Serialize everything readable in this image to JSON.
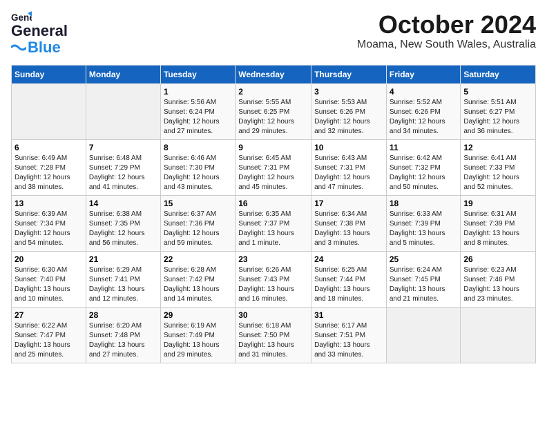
{
  "logo": {
    "general": "General",
    "blue": "Blue"
  },
  "header": {
    "month": "October 2024",
    "location": "Moama, New South Wales, Australia"
  },
  "weekdays": [
    "Sunday",
    "Monday",
    "Tuesday",
    "Wednesday",
    "Thursday",
    "Friday",
    "Saturday"
  ],
  "weeks": [
    [
      {
        "day": "",
        "info": ""
      },
      {
        "day": "",
        "info": ""
      },
      {
        "day": "1",
        "info": "Sunrise: 5:56 AM\nSunset: 6:24 PM\nDaylight: 12 hours\nand 27 minutes."
      },
      {
        "day": "2",
        "info": "Sunrise: 5:55 AM\nSunset: 6:25 PM\nDaylight: 12 hours\nand 29 minutes."
      },
      {
        "day": "3",
        "info": "Sunrise: 5:53 AM\nSunset: 6:26 PM\nDaylight: 12 hours\nand 32 minutes."
      },
      {
        "day": "4",
        "info": "Sunrise: 5:52 AM\nSunset: 6:26 PM\nDaylight: 12 hours\nand 34 minutes."
      },
      {
        "day": "5",
        "info": "Sunrise: 5:51 AM\nSunset: 6:27 PM\nDaylight: 12 hours\nand 36 minutes."
      }
    ],
    [
      {
        "day": "6",
        "info": "Sunrise: 6:49 AM\nSunset: 7:28 PM\nDaylight: 12 hours\nand 38 minutes."
      },
      {
        "day": "7",
        "info": "Sunrise: 6:48 AM\nSunset: 7:29 PM\nDaylight: 12 hours\nand 41 minutes."
      },
      {
        "day": "8",
        "info": "Sunrise: 6:46 AM\nSunset: 7:30 PM\nDaylight: 12 hours\nand 43 minutes."
      },
      {
        "day": "9",
        "info": "Sunrise: 6:45 AM\nSunset: 7:31 PM\nDaylight: 12 hours\nand 45 minutes."
      },
      {
        "day": "10",
        "info": "Sunrise: 6:43 AM\nSunset: 7:31 PM\nDaylight: 12 hours\nand 47 minutes."
      },
      {
        "day": "11",
        "info": "Sunrise: 6:42 AM\nSunset: 7:32 PM\nDaylight: 12 hours\nand 50 minutes."
      },
      {
        "day": "12",
        "info": "Sunrise: 6:41 AM\nSunset: 7:33 PM\nDaylight: 12 hours\nand 52 minutes."
      }
    ],
    [
      {
        "day": "13",
        "info": "Sunrise: 6:39 AM\nSunset: 7:34 PM\nDaylight: 12 hours\nand 54 minutes."
      },
      {
        "day": "14",
        "info": "Sunrise: 6:38 AM\nSunset: 7:35 PM\nDaylight: 12 hours\nand 56 minutes."
      },
      {
        "day": "15",
        "info": "Sunrise: 6:37 AM\nSunset: 7:36 PM\nDaylight: 12 hours\nand 59 minutes."
      },
      {
        "day": "16",
        "info": "Sunrise: 6:35 AM\nSunset: 7:37 PM\nDaylight: 13 hours\nand 1 minute."
      },
      {
        "day": "17",
        "info": "Sunrise: 6:34 AM\nSunset: 7:38 PM\nDaylight: 13 hours\nand 3 minutes."
      },
      {
        "day": "18",
        "info": "Sunrise: 6:33 AM\nSunset: 7:39 PM\nDaylight: 13 hours\nand 5 minutes."
      },
      {
        "day": "19",
        "info": "Sunrise: 6:31 AM\nSunset: 7:39 PM\nDaylight: 13 hours\nand 8 minutes."
      }
    ],
    [
      {
        "day": "20",
        "info": "Sunrise: 6:30 AM\nSunset: 7:40 PM\nDaylight: 13 hours\nand 10 minutes."
      },
      {
        "day": "21",
        "info": "Sunrise: 6:29 AM\nSunset: 7:41 PM\nDaylight: 13 hours\nand 12 minutes."
      },
      {
        "day": "22",
        "info": "Sunrise: 6:28 AM\nSunset: 7:42 PM\nDaylight: 13 hours\nand 14 minutes."
      },
      {
        "day": "23",
        "info": "Sunrise: 6:26 AM\nSunset: 7:43 PM\nDaylight: 13 hours\nand 16 minutes."
      },
      {
        "day": "24",
        "info": "Sunrise: 6:25 AM\nSunset: 7:44 PM\nDaylight: 13 hours\nand 18 minutes."
      },
      {
        "day": "25",
        "info": "Sunrise: 6:24 AM\nSunset: 7:45 PM\nDaylight: 13 hours\nand 21 minutes."
      },
      {
        "day": "26",
        "info": "Sunrise: 6:23 AM\nSunset: 7:46 PM\nDaylight: 13 hours\nand 23 minutes."
      }
    ],
    [
      {
        "day": "27",
        "info": "Sunrise: 6:22 AM\nSunset: 7:47 PM\nDaylight: 13 hours\nand 25 minutes."
      },
      {
        "day": "28",
        "info": "Sunrise: 6:20 AM\nSunset: 7:48 PM\nDaylight: 13 hours\nand 27 minutes."
      },
      {
        "day": "29",
        "info": "Sunrise: 6:19 AM\nSunset: 7:49 PM\nDaylight: 13 hours\nand 29 minutes."
      },
      {
        "day": "30",
        "info": "Sunrise: 6:18 AM\nSunset: 7:50 PM\nDaylight: 13 hours\nand 31 minutes."
      },
      {
        "day": "31",
        "info": "Sunrise: 6:17 AM\nSunset: 7:51 PM\nDaylight: 13 hours\nand 33 minutes."
      },
      {
        "day": "",
        "info": ""
      },
      {
        "day": "",
        "info": ""
      }
    ]
  ]
}
